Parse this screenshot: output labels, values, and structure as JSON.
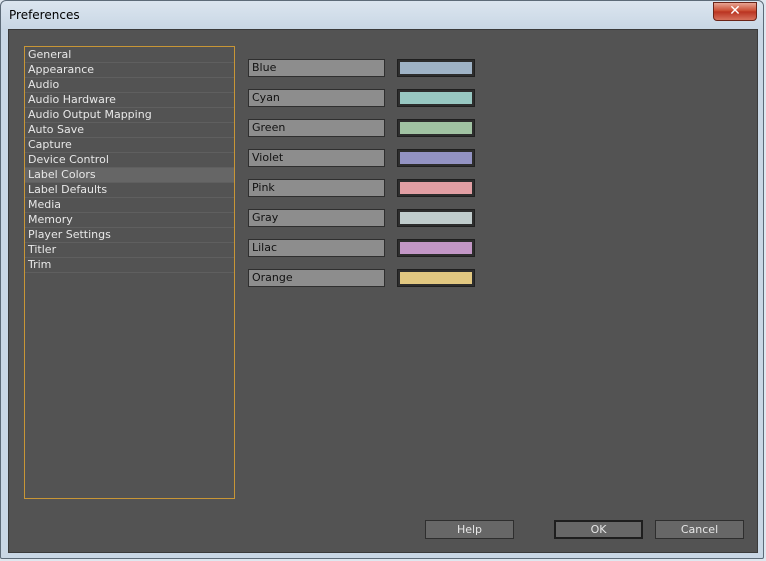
{
  "window": {
    "title": "Preferences",
    "close_glyph": "✕"
  },
  "sidebar": {
    "items": [
      {
        "label": "General"
      },
      {
        "label": "Appearance"
      },
      {
        "label": "Audio"
      },
      {
        "label": "Audio Hardware"
      },
      {
        "label": "Audio Output Mapping"
      },
      {
        "label": "Auto Save"
      },
      {
        "label": "Capture"
      },
      {
        "label": "Device Control"
      },
      {
        "label": "Label Colors",
        "selected": true
      },
      {
        "label": "Label Defaults"
      },
      {
        "label": "Media"
      },
      {
        "label": "Memory"
      },
      {
        "label": "Player Settings"
      },
      {
        "label": "Titler"
      },
      {
        "label": "Trim"
      }
    ]
  },
  "labels": [
    {
      "name": "Blue",
      "color": "#9fb3c6"
    },
    {
      "name": "Cyan",
      "color": "#98c8c2"
    },
    {
      "name": "Green",
      "color": "#a1c3a3"
    },
    {
      "name": "Violet",
      "color": "#9393c3"
    },
    {
      "name": "Pink",
      "color": "#e29fa4"
    },
    {
      "name": "Gray",
      "color": "#c0cccc"
    },
    {
      "name": "Lilac",
      "color": "#c397c6"
    },
    {
      "name": "Orange",
      "color": "#e2c881"
    }
  ],
  "buttons": {
    "help": "Help",
    "ok": "OK",
    "cancel": "Cancel"
  }
}
